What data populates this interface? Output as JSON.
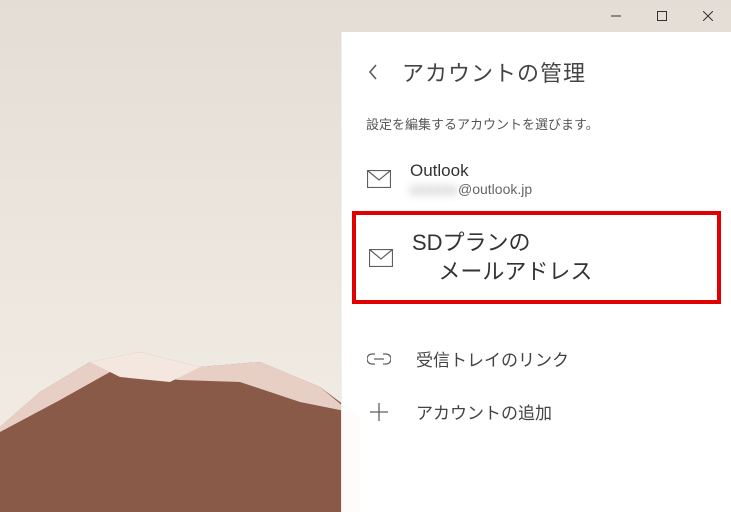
{
  "panel": {
    "title": "アカウントの管理",
    "subtitle": "設定を編集するアカウントを選びます。"
  },
  "accounts": [
    {
      "name": "Outlook",
      "email_hidden_prefix": "xxxxxx",
      "email_visible_suffix": "@outlook.jp"
    }
  ],
  "highlight": {
    "line1": "SDプランの",
    "line2": "メールアドレス"
  },
  "options": {
    "link_inboxes": "受信トレイのリンク",
    "add_account": "アカウントの追加"
  }
}
